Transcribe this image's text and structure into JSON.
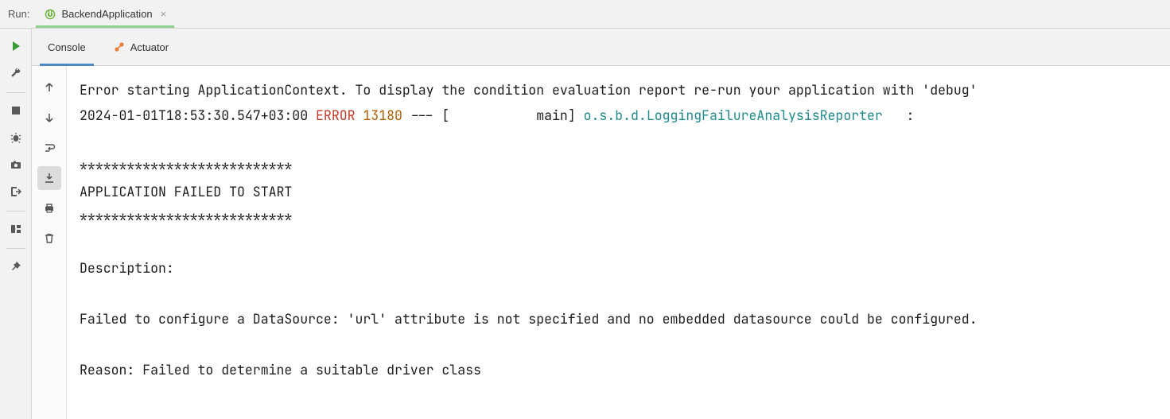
{
  "header": {
    "run_label": "Run:",
    "config_name": "BackendApplication"
  },
  "tabs": {
    "console": "Console",
    "actuator": "Actuator"
  },
  "log": {
    "line1": "Error starting ApplicationContext. To display the condition evaluation report re-run your application with 'debug'",
    "ts": "2024-01-01T18:53:30.547+03:00",
    "level": "ERROR",
    "pid": "13180",
    "sep": " --- [           main] ",
    "logger": "o.s.b.d.LoggingFailureAnalysisReporter",
    "tail": "   :",
    "stars": "***************************",
    "fail": "APPLICATION FAILED TO START",
    "desc_h": "Description:",
    "desc": "Failed to configure a DataSource: 'url' attribute is not specified and no embedded datasource could be configured.",
    "reason": "Reason: Failed to determine a suitable driver class"
  }
}
